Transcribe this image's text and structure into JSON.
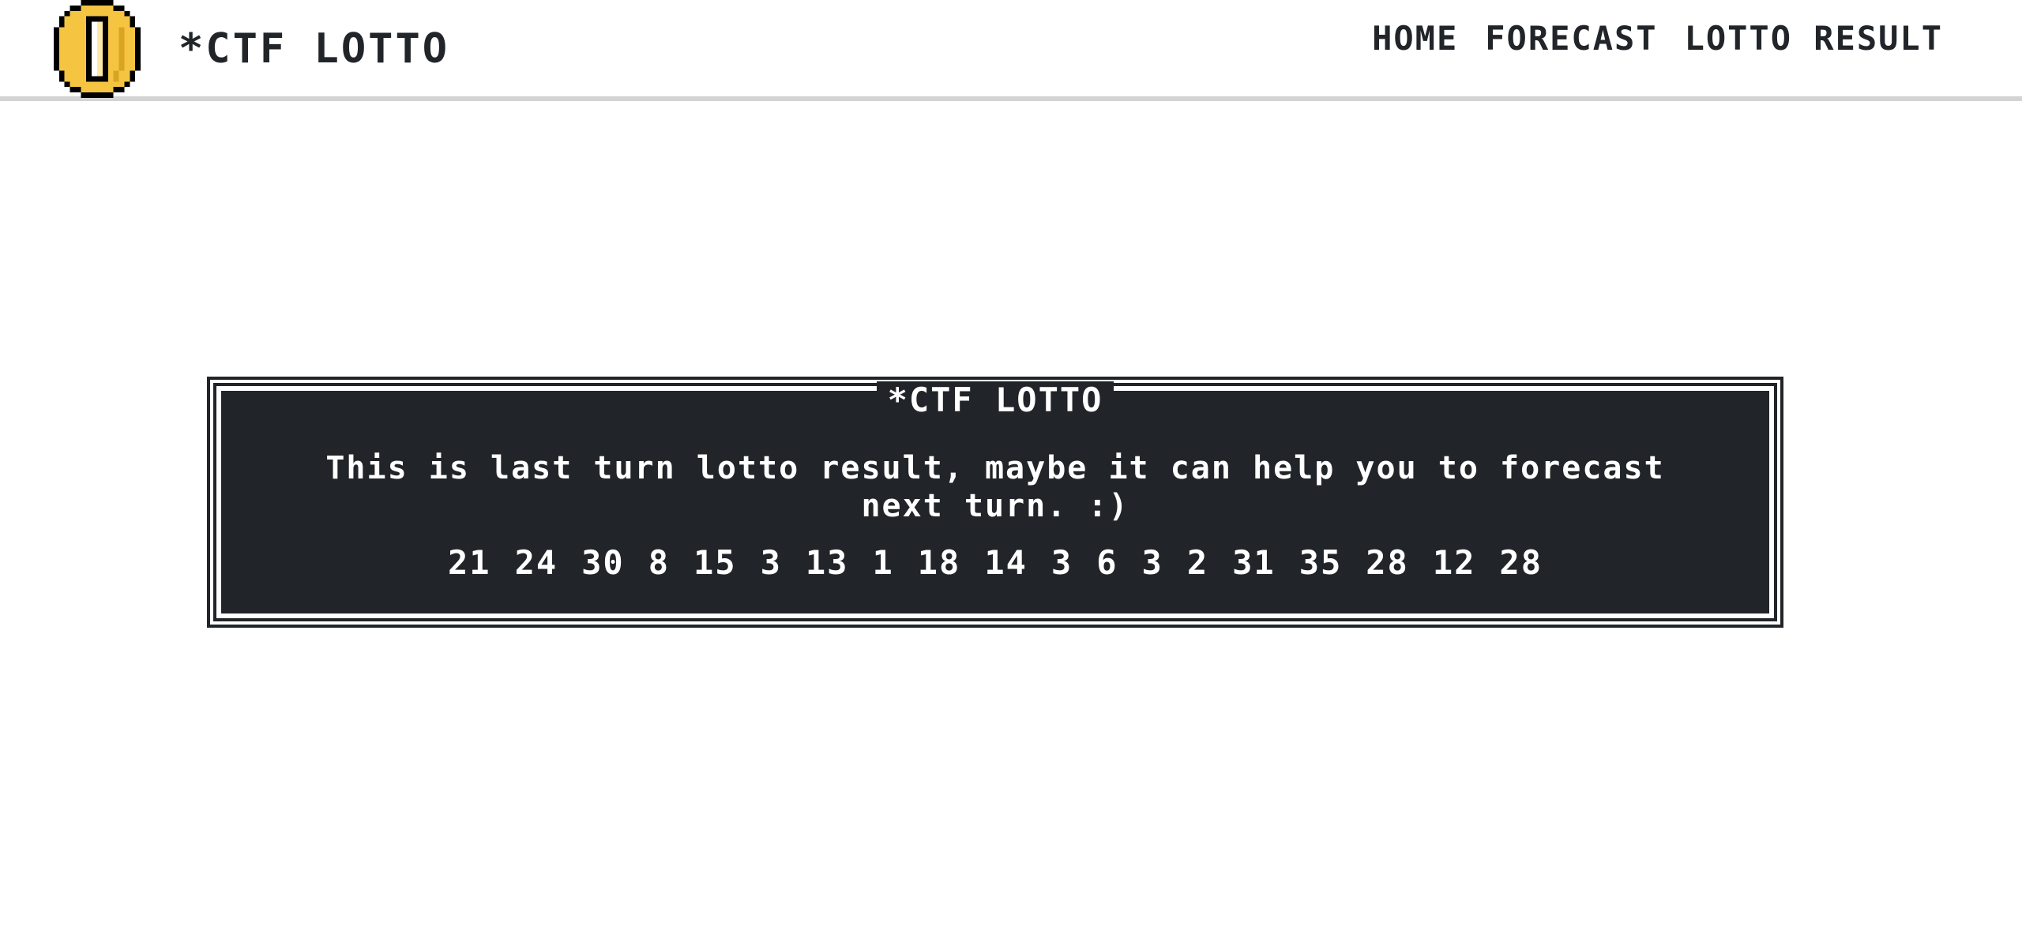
{
  "header": {
    "brand": "*CTF LOTTO",
    "logo_icon": "gold-coin-icon",
    "nav": [
      "HOME",
      "FORECAST",
      "LOTTO RESULT"
    ]
  },
  "panel": {
    "title": "*CTF LOTTO",
    "message": "This is last turn lotto result, maybe it can help you to forecast next turn. :)",
    "numbers": [
      "21",
      "24",
      "30",
      "8",
      "15",
      "3",
      "13",
      "1",
      "18",
      "14",
      "3",
      "6",
      "3",
      "2",
      "31",
      "35",
      "28",
      "12",
      "28"
    ]
  },
  "colors": {
    "dark": "#212529",
    "coin_gold": "#f5c542",
    "divider": "#d3d3d3"
  }
}
